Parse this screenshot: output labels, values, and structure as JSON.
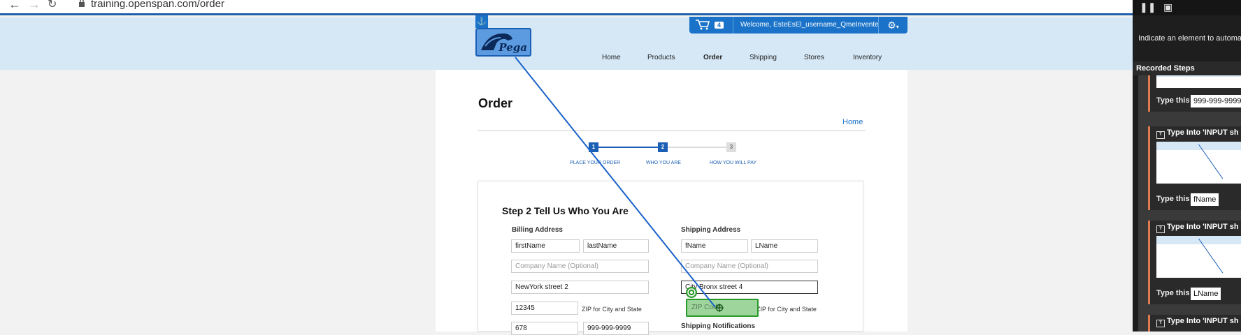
{
  "browser": {
    "url": "training.openspan.com/order"
  },
  "header": {
    "cart_count": "4",
    "welcome": "Welcome, EsteEsEl_username_QmeInvente",
    "logo_text": "Pega",
    "nav": [
      "Home",
      "Products",
      "Order",
      "Shipping",
      "Stores",
      "Inventory"
    ]
  },
  "page": {
    "title": "Order",
    "home_link": "Home",
    "steps": [
      {
        "num": "1",
        "label": "PLACE YOUR ORDER"
      },
      {
        "num": "2",
        "label": "WHO YOU ARE"
      },
      {
        "num": "3",
        "label": "HOW YOU WILL PAY"
      }
    ],
    "step_title": "Step 2 Tell Us Who You Are"
  },
  "billing": {
    "title": "Billing Address",
    "first_name": "firstName",
    "last_name": "lastName",
    "company_placeholder": "Company Name (Optional)",
    "street": "NewYork street 2",
    "zip": "12345",
    "zip_label": "ZIP for City and State",
    "phone_part": "678",
    "phone": "999-999-9999"
  },
  "shipping": {
    "title": "Shipping Address",
    "first_name": "fName",
    "last_name": "LName",
    "company_placeholder": "Company Name (Optional)",
    "street": "City Bronx street 4",
    "zip_placeholder": "ZIP Code",
    "zip_label": "ZIP for City and State",
    "notifications_title": "Shipping Notifications"
  },
  "recorder": {
    "hint": "Indicate an element to automate",
    "recorded_steps_title": "Recorded Steps",
    "steps": [
      {
        "type_label": "Type this",
        "value": "999-999-9999"
      },
      {
        "title": "Type Into 'INPUT sh",
        "type_label": "Type this",
        "value": "fName"
      },
      {
        "title": "Type Into 'INPUT sh",
        "type_label": "Type this",
        "value": "LName"
      },
      {
        "title": "Type Into 'INPUT sh"
      }
    ]
  },
  "colors": {
    "brand_blue": "#1a73c8",
    "header_band": "#d6e8f6",
    "highlight_green": "#2a9a2a",
    "step_accent": "#e07a4f"
  }
}
